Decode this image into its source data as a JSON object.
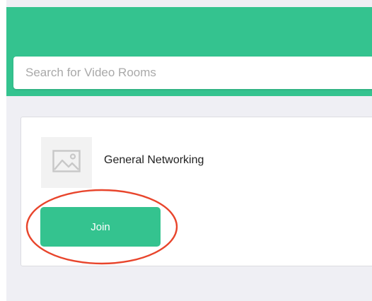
{
  "colors": {
    "brand_green": "#34c38f",
    "page_background": "#efeff4",
    "annotation_red": "#e8452c"
  },
  "search": {
    "placeholder": "Search for Video Rooms",
    "value": ""
  },
  "rooms": [
    {
      "thumbnail_icon": "image-placeholder-icon",
      "name": "General Networking",
      "join_label": "Join"
    }
  ],
  "annotation": {
    "shape": "ellipse",
    "highlights": "join-button"
  }
}
